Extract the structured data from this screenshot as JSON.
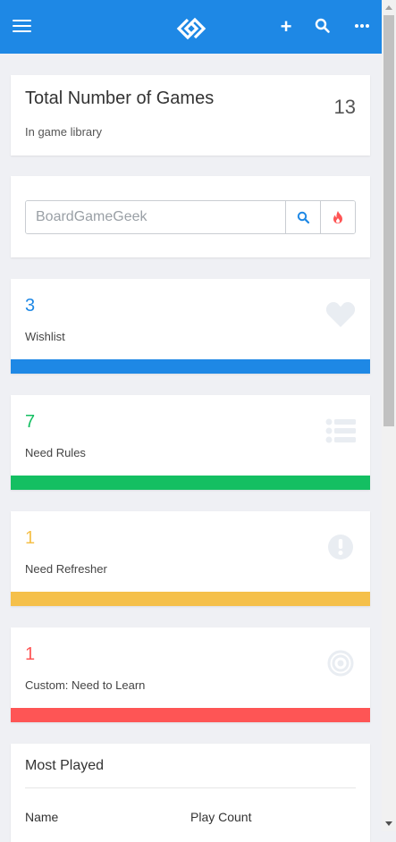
{
  "colors": {
    "topbar": "#1e88e5",
    "wishlist": "#1e88e5",
    "need_rules": "#14bf62",
    "need_refresher": "#f5c04a",
    "custom": "#fe5555"
  },
  "topbar": {
    "menu_icon": "hamburger-menu-icon",
    "logo_icon": "app-logo-icon",
    "add_icon": "plus-icon",
    "search_icon": "search-icon",
    "more_icon": "more-dots-icon",
    "add_glyph": "+"
  },
  "total": {
    "title": "Total Number of Games",
    "count": "13",
    "subtitle": "In game library"
  },
  "search": {
    "placeholder": "BoardGameGeek",
    "search_icon": "search-icon",
    "hot_icon": "fire-icon"
  },
  "stats": [
    {
      "count": "3",
      "label": "Wishlist",
      "icon": "heart-icon"
    },
    {
      "count": "7",
      "label": "Need Rules",
      "icon": "list-icon"
    },
    {
      "count": "1",
      "label": "Need Refresher",
      "icon": "exclamation-circle-icon"
    },
    {
      "count": "1",
      "label": "Custom: Need to Learn",
      "icon": "target-icon"
    }
  ],
  "most_played": {
    "title": "Most Played",
    "columns": [
      "Name",
      "Play Count"
    ]
  }
}
